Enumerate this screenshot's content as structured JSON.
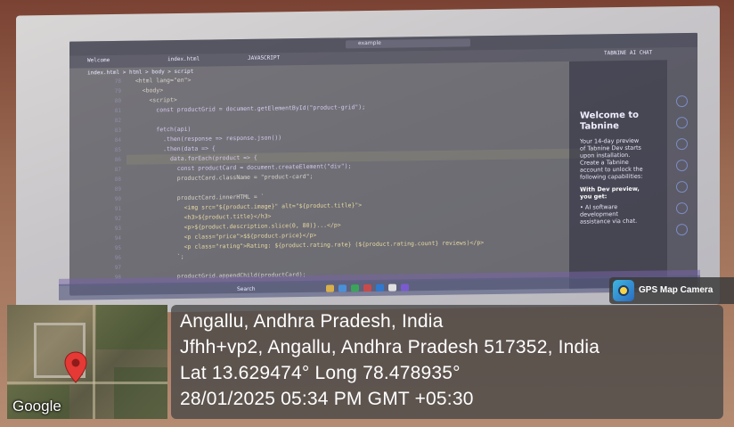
{
  "editor": {
    "tabs": [
      "Welcome",
      "index.html",
      "JAVASCRIPT"
    ],
    "search_placeholder": "example",
    "breadcrumb": "index.html > html > body > script",
    "panel_header": "TABNINE AI CHAT",
    "line_numbers": [
      "78",
      "79",
      "80",
      "81",
      "82",
      "83",
      "84",
      "85",
      "86",
      "87",
      "88",
      "89",
      "90",
      "91",
      "92",
      "93",
      "94",
      "95",
      "96",
      "97",
      "98"
    ],
    "code_lines": [
      "  <html lang=\"en\">",
      "    <body>",
      "      <script>",
      "        const productGrid = document.getElementById(\"product-grid\");",
      "",
      "        fetch(api)",
      "          .then(response => response.json())",
      "          .then(data => {",
      "            data.forEach(product => {",
      "              const productCard = document.createElement(\"div\");",
      "              productCard.className = \"product-card\";",
      "",
      "              productCard.innerHTML = `",
      "                <img src=\"${product.image}\" alt=\"${product.title}\">",
      "                <h3>${product.title}</h3>",
      "                <p>${product.description.slice(0, 80)}...</p>",
      "                <p class=\"price\">$${product.price}</p>",
      "                <p class=\"rating\">Rating: ${product.rating.rate} (${product.rating.count} reviews)</p>",
      "              `;",
      "",
      "              productGrid.appendChild(productCard);",
      "            });"
    ]
  },
  "tabnine_panel": {
    "title": "Welcome to Tabnine",
    "body": "Your 14-day preview of Tabnine Dev starts upon installation. Create a Tabnine account to unlock the following capabilities:",
    "subtitle": "With Dev preview, you get:",
    "bullet": "• AI software development assistance via chat."
  },
  "taskbar": {
    "search_label": "Search"
  },
  "gps_overlay": {
    "badge": "GPS Map Camera",
    "map_provider": "Google",
    "location": "Angallu, Andhra Pradesh, India",
    "address": "Jfhh+vp2, Angallu, Andhra Pradesh 517352, India",
    "coordinates": "Lat 13.629474° Long 78.478935°",
    "datetime": "28/01/2025 05:34 PM GMT +05:30"
  },
  "colors": {
    "overlay_bg": "#464646",
    "pin": "#e53935",
    "editor_bg": "#2a2a36"
  }
}
